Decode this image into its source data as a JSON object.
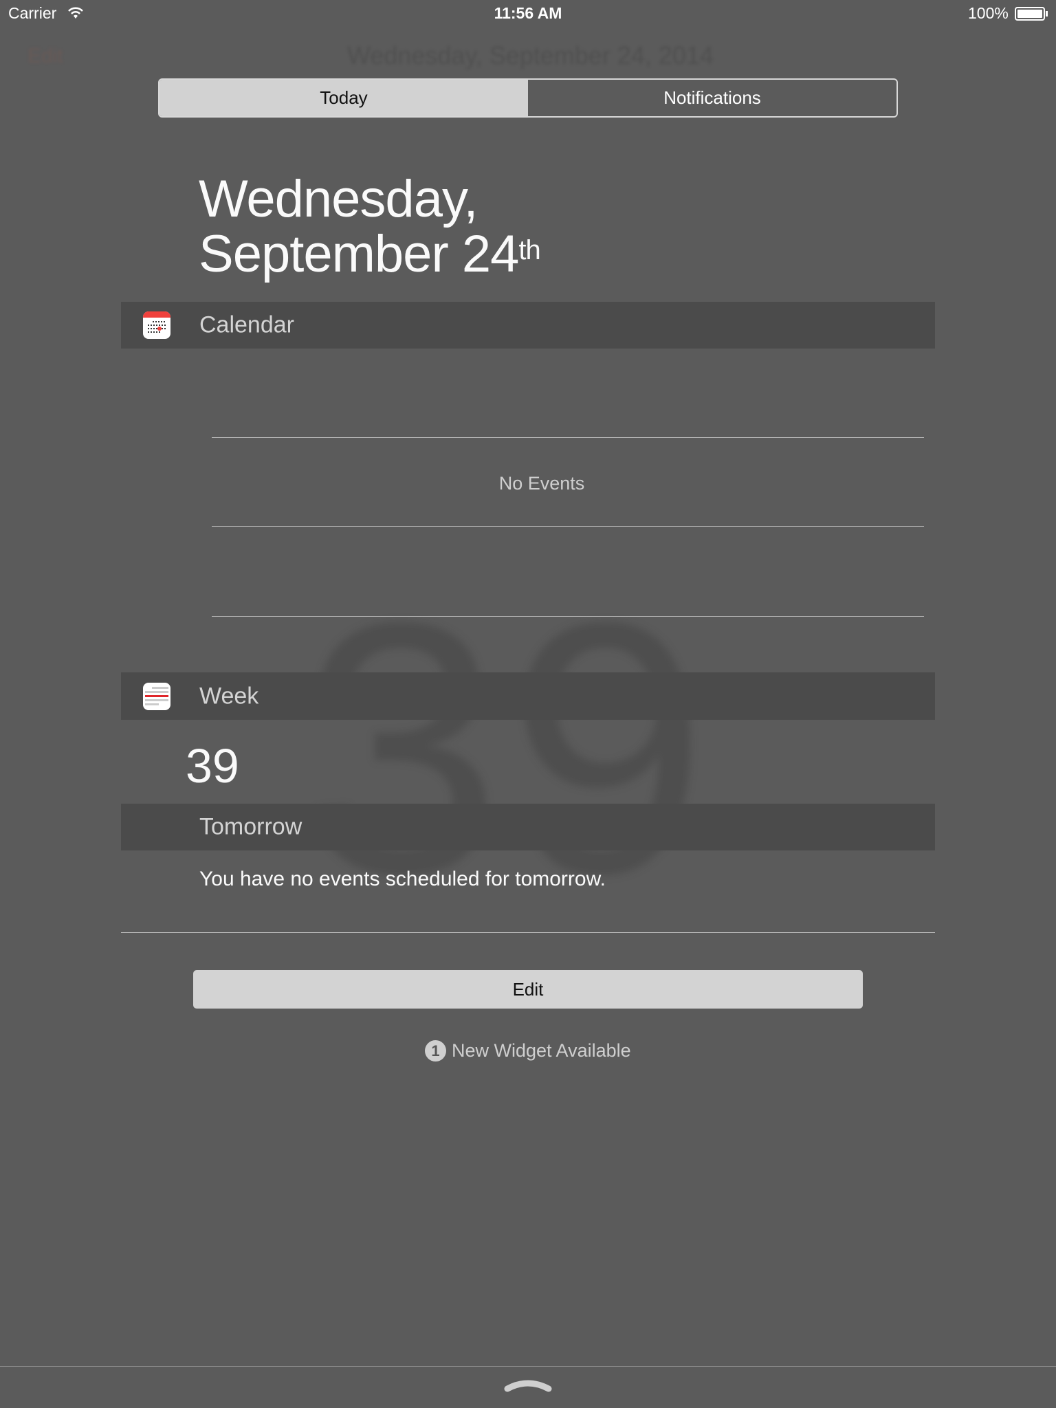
{
  "status_bar": {
    "carrier": "Carrier",
    "time": "11:56 AM",
    "battery": "100%",
    "battery_level": 1.0
  },
  "background": {
    "date": "Wednesday, September 24, 2014",
    "edit": "Edit",
    "week_number": "39"
  },
  "segmented": {
    "today": "Today",
    "notifications": "Notifications",
    "selected": "Today"
  },
  "date": {
    "line1": "Wednesday,",
    "line2": "September 24",
    "suffix": "th"
  },
  "calendar": {
    "title": "Calendar",
    "empty": "No Events"
  },
  "week": {
    "title": "Week",
    "number": "39"
  },
  "tomorrow": {
    "title": "Tomorrow",
    "message": "You have no events scheduled for tomorrow."
  },
  "edit_button": "Edit",
  "new_widget": {
    "count": "1",
    "label": "New Widget Available"
  },
  "colors": {
    "background": "#5b5b5b",
    "band": "#4b4b4b",
    "calendar_red": "#f0413c"
  }
}
